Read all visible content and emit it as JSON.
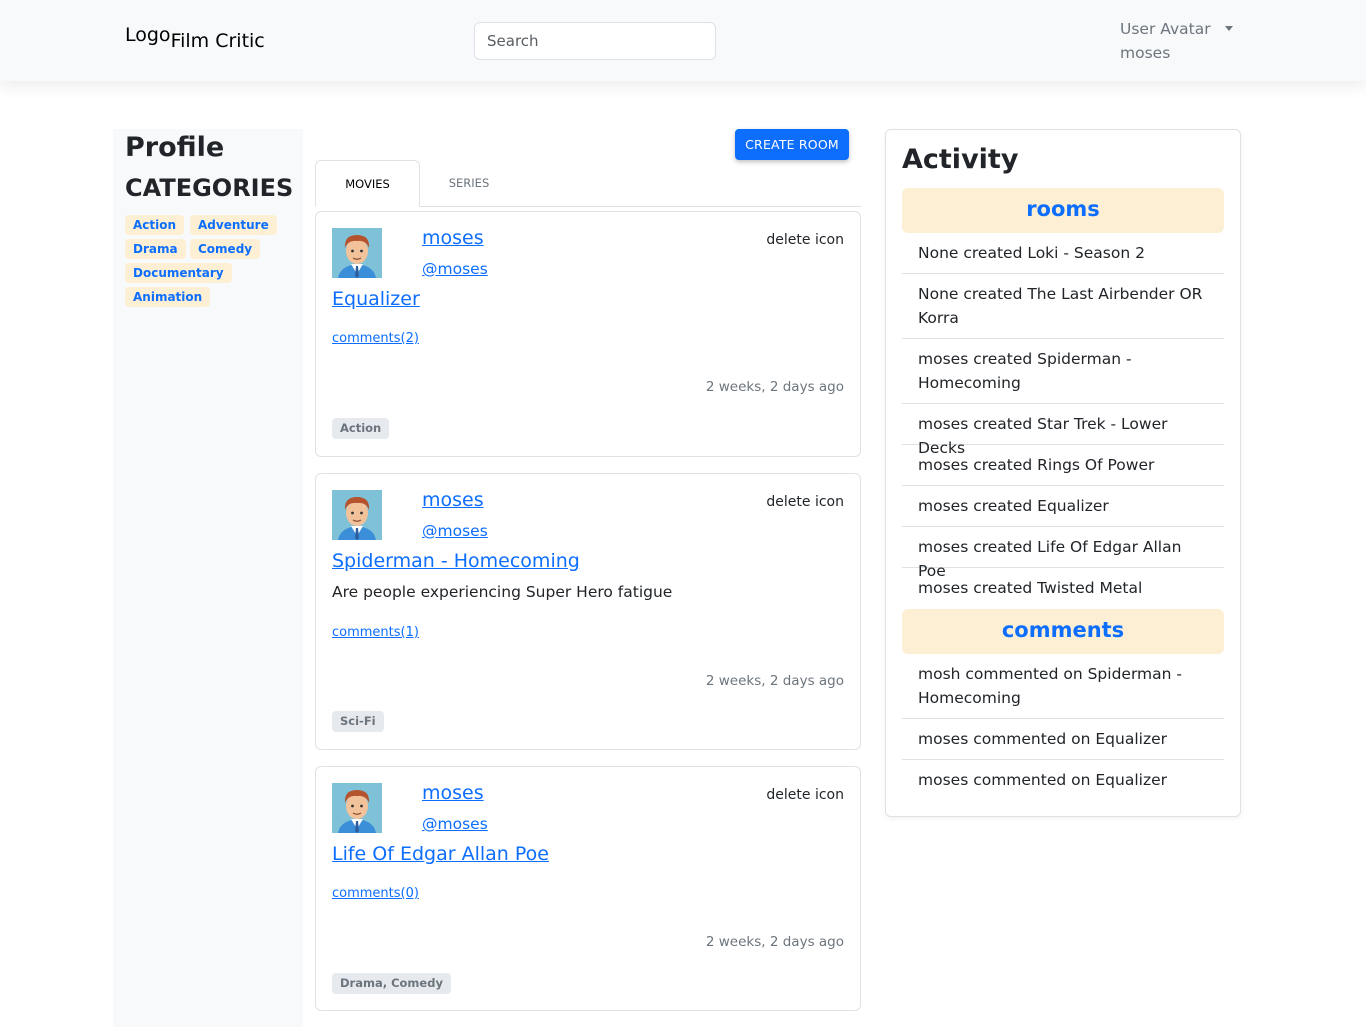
{
  "navbar": {
    "logo_alt": "Logo",
    "brand": "Film Critic",
    "search_placeholder": "Search",
    "user_avatar_alt": "User Avatar",
    "username": "moses"
  },
  "sidebar": {
    "title": "Profile",
    "categories_title": "CATEGORIES",
    "categories": [
      "Action",
      "Adventure",
      "Drama",
      "Comedy",
      "Documentary",
      "Animation"
    ]
  },
  "main": {
    "create_button": "CREATE ROOM",
    "tabs": [
      {
        "label": "MOVIES",
        "active": true
      },
      {
        "label": "SERIES",
        "active": false
      }
    ],
    "rooms": [
      {
        "user": "moses",
        "handle": "@moses",
        "delete": "delete icon",
        "title": "Equalizer",
        "description": "",
        "comments": "comments(2)",
        "time": "2 weeks, 2 days ago",
        "tags": "Action"
      },
      {
        "user": "moses",
        "handle": "@moses",
        "delete": "delete icon",
        "title": "Spiderman - Homecoming",
        "description": "Are people experiencing Super Hero fatigue",
        "comments": "comments(1)",
        "time": "2 weeks, 2 days ago",
        "tags": "Sci-Fi"
      },
      {
        "user": "moses",
        "handle": "@moses",
        "delete": "delete icon",
        "title": "Life Of Edgar Allan Poe",
        "description": "",
        "comments": "comments(0)",
        "time": "2 weeks, 2 days ago",
        "tags": "Drama, Comedy"
      }
    ]
  },
  "activity": {
    "title": "Activity",
    "rooms_header": "rooms",
    "rooms": [
      "None created Loki - Season 2",
      "None created The Last Airbender OR Korra",
      "moses created Spiderman - Homecoming",
      "moses created Star Trek - Lower Decks",
      "moses created Rings Of Power",
      "moses created Equalizer",
      "moses created Life Of Edgar Allan Poe",
      "moses created Twisted Metal"
    ],
    "comments_header": "comments",
    "comments": [
      "mosh commented on Spiderman - Homecoming",
      "moses commented on Equalizer",
      "moses commented on Equalizer"
    ]
  },
  "colors": {
    "primary": "#0d6efd",
    "badge_bg": "#fcefd4",
    "navbar_bg": "#f8f9fa",
    "tag_bg": "#e6e9ee"
  }
}
